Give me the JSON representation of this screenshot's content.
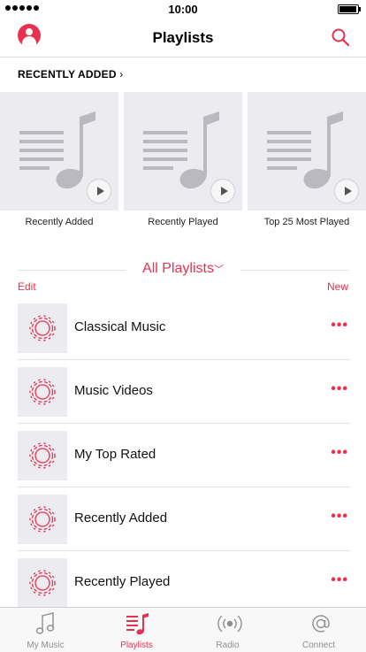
{
  "status_bar": {
    "time": "10:00"
  },
  "header": {
    "title": "Playlists"
  },
  "recent": {
    "section_label": "RECENTLY ADDED",
    "chevron": "›",
    "tiles": [
      {
        "label": "Recently Added"
      },
      {
        "label": "Recently Played"
      },
      {
        "label": "Top 25 Most Played"
      }
    ]
  },
  "all_playlists": {
    "title": "All Playlists",
    "chevron": "﹀",
    "edit_label": "Edit",
    "new_label": "New",
    "items": [
      {
        "title": "Classical Music"
      },
      {
        "title": "Music Videos"
      },
      {
        "title": "My Top Rated"
      },
      {
        "title": "Recently Added"
      },
      {
        "title": "Recently Played"
      }
    ],
    "more_label": "•••"
  },
  "tabs": [
    {
      "label": "My Music",
      "icon": "note-icon",
      "active": false
    },
    {
      "label": "Playlists",
      "icon": "playlist-icon",
      "active": true
    },
    {
      "label": "Radio",
      "icon": "radio-icon",
      "active": false
    },
    {
      "label": "Connect",
      "icon": "at-icon",
      "active": false
    }
  ],
  "colors": {
    "accent": "#e8304f",
    "tile_bg": "#ececf0",
    "inactive": "#8e8e93"
  }
}
